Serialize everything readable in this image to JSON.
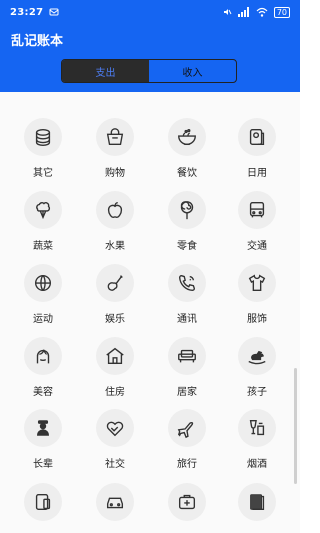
{
  "status_bar": {
    "time": "23:27",
    "battery": "70"
  },
  "app": {
    "title": "乱记账本"
  },
  "tabs": [
    {
      "label": "支出",
      "active": true
    },
    {
      "label": "收入",
      "active": false
    }
  ],
  "categories": [
    {
      "label": "其它",
      "icon": "coins-icon"
    },
    {
      "label": "购物",
      "icon": "shopping-basket-icon"
    },
    {
      "label": "餐饮",
      "icon": "rice-bowl-icon"
    },
    {
      "label": "日用",
      "icon": "toilet-paper-icon"
    },
    {
      "label": "蔬菜",
      "icon": "cauliflower-icon"
    },
    {
      "label": "水果",
      "icon": "apple-icon"
    },
    {
      "label": "零食",
      "icon": "lollipop-icon"
    },
    {
      "label": "交通",
      "icon": "bus-icon"
    },
    {
      "label": "运动",
      "icon": "ball-icon"
    },
    {
      "label": "娱乐",
      "icon": "guitar-icon"
    },
    {
      "label": "通讯",
      "icon": "phone-icon"
    },
    {
      "label": "服饰",
      "icon": "shirt-icon"
    },
    {
      "label": "美容",
      "icon": "face-icon"
    },
    {
      "label": "住房",
      "icon": "house-icon"
    },
    {
      "label": "居家",
      "icon": "sofa-icon"
    },
    {
      "label": "孩子",
      "icon": "rocking-horse-icon"
    },
    {
      "label": "长辈",
      "icon": "elder-icon"
    },
    {
      "label": "社交",
      "icon": "handshake-heart-icon"
    },
    {
      "label": "旅行",
      "icon": "airplane-icon"
    },
    {
      "label": "烟酒",
      "icon": "wine-glass-icon"
    },
    {
      "label": "",
      "icon": "tablet-icon"
    },
    {
      "label": "",
      "icon": "car-icon"
    },
    {
      "label": "",
      "icon": "medical-kit-icon"
    },
    {
      "label": "",
      "icon": "book-icon"
    }
  ],
  "colors": {
    "appbar": "#1565f2",
    "tab_active_bg": "#2b2b2b",
    "tab_active_text": "#4d7ef5"
  }
}
